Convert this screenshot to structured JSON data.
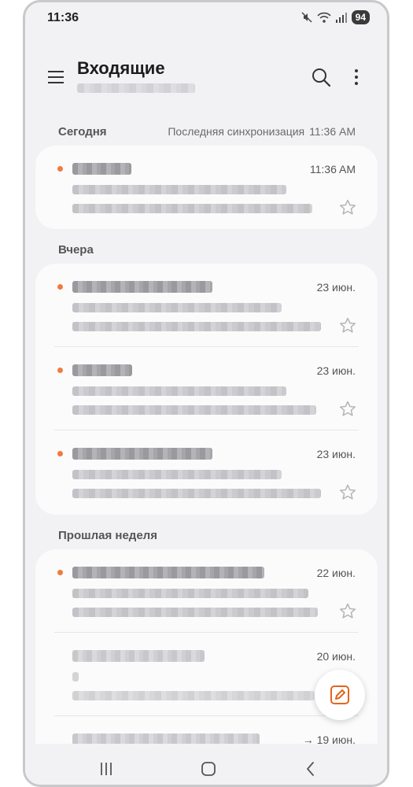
{
  "status": {
    "time": "11:36",
    "battery": "94"
  },
  "header": {
    "title": "Входящие"
  },
  "sections": {
    "today": "Сегодня",
    "yesterday": "Вчера",
    "last_week": "Прошлая неделя"
  },
  "sync": {
    "label": "Последняя синхронизация",
    "time": "11:36 AM"
  },
  "mails": [
    {
      "date": "11:36 AM",
      "unread": true
    },
    {
      "date": "23 июн.",
      "unread": true
    },
    {
      "date": "23 июн.",
      "unread": true
    },
    {
      "date": "23 июн.",
      "unread": true
    },
    {
      "date": "22 июн.",
      "unread": true
    },
    {
      "date": "20 июн.",
      "unread": false
    },
    {
      "date": "→ 19 июн.",
      "unread": false
    }
  ],
  "icons": {
    "menu": "hamburger-icon",
    "search": "search-icon",
    "more": "more-vertical-icon",
    "star": "star-outline-icon",
    "compose": "edit-pencil-icon"
  },
  "colors": {
    "accent": "#f07b3f",
    "unread_dot": "#f07b3f",
    "compose": "#e2661c"
  }
}
